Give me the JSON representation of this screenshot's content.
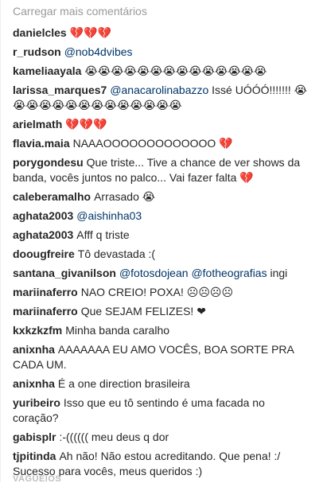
{
  "load_more": "Carregar mais comentários",
  "comments": [
    {
      "user": "danielcles",
      "parts": [
        {
          "t": "text",
          "v": "💔💔💔"
        }
      ]
    },
    {
      "user": "r_rudson",
      "parts": [
        {
          "t": "mention",
          "v": "@nob4dvibes"
        }
      ]
    },
    {
      "user": "kameliaayala",
      "parts": [
        {
          "t": "text",
          "v": "😭😭😭😭😭😭😭😭😭😭😭😭😭😭"
        }
      ]
    },
    {
      "user": "larissa_marques7",
      "parts": [
        {
          "t": "mention",
          "v": "@anacarolinabazzo"
        },
        {
          "t": "text",
          "v": " Issé UÓÓÓ!!!!!!! 😭😭😭😭😭😭😭😭😭😭😭😭😭😭"
        }
      ]
    },
    {
      "user": "arielmath",
      "parts": [
        {
          "t": "text",
          "v": "💔💔💔"
        }
      ]
    },
    {
      "user": "flavia.maia",
      "parts": [
        {
          "t": "text",
          "v": "NAAAOOOOOOOOOOOOO 💔"
        }
      ]
    },
    {
      "user": "porygondesu",
      "parts": [
        {
          "t": "text",
          "v": "Que triste... Tive a chance de ver shows da banda, vocês juntos no palco... Vai fazer falta 💔"
        }
      ]
    },
    {
      "user": "caleberamalho",
      "parts": [
        {
          "t": "text",
          "v": "Arrasado 😭"
        }
      ]
    },
    {
      "user": "aghata2003",
      "parts": [
        {
          "t": "mention",
          "v": "@aishinha03"
        }
      ]
    },
    {
      "user": "aghata2003",
      "parts": [
        {
          "t": "text",
          "v": "Afff q triste"
        }
      ]
    },
    {
      "user": "doougfreire",
      "parts": [
        {
          "t": "text",
          "v": "Tô devastada :("
        }
      ]
    },
    {
      "user": "santana_givanilson",
      "parts": [
        {
          "t": "mention",
          "v": "@fotosdojean"
        },
        {
          "t": "text",
          "v": " "
        },
        {
          "t": "mention",
          "v": "@fotheografias"
        },
        {
          "t": "text",
          "v": " ingi"
        }
      ]
    },
    {
      "user": "mariinaferro",
      "parts": [
        {
          "t": "text",
          "v": "NAO CREIO! POXA! ☹☹☹☹"
        }
      ]
    },
    {
      "user": "mariinaferro",
      "parts": [
        {
          "t": "text",
          "v": "Que SEJAM FELIZES! ❤"
        }
      ]
    },
    {
      "user": "kxkzkzfm",
      "parts": [
        {
          "t": "text",
          "v": "Minha banda caralho"
        }
      ]
    },
    {
      "user": "anixnha",
      "parts": [
        {
          "t": "text",
          "v": "AAAAAAA EU AMO VOCÊS, BOA SORTE PRA CADA UM."
        }
      ]
    },
    {
      "user": "anixnha",
      "parts": [
        {
          "t": "text",
          "v": "É a one direction brasileira"
        }
      ]
    },
    {
      "user": "yuribeiro",
      "parts": [
        {
          "t": "text",
          "v": "Isso que eu tô sentindo é uma facada no coração?"
        }
      ]
    },
    {
      "user": "gabisplr",
      "parts": [
        {
          "t": "text",
          "v": ":-(((((( meu deus q dor"
        }
      ]
    },
    {
      "user": "tjpitinda",
      "parts": [
        {
          "t": "text",
          "v": "Ah não! Não estou acreditando. Que pena! :/ Sucesso para vocês, meus queridos :)"
        }
      ]
    }
  ],
  "cut_row_text": "VAGUEIOS"
}
